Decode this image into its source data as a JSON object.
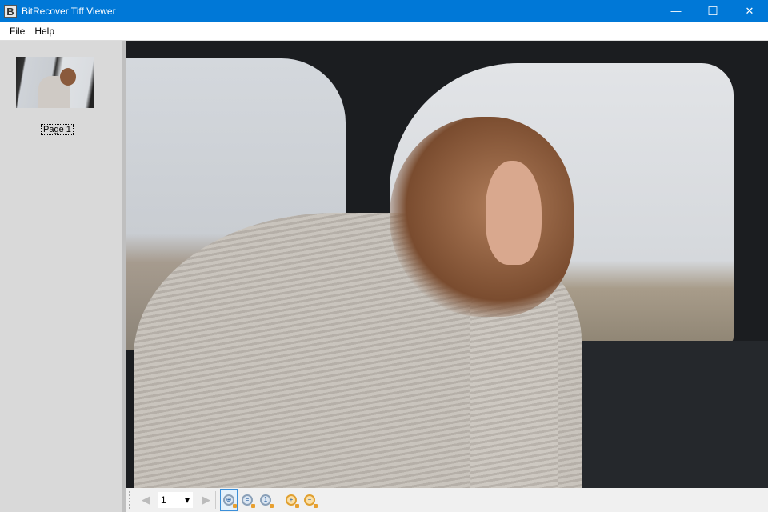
{
  "window": {
    "title": "BitRecover Tiff Viewer",
    "app_icon_letter": "B",
    "minimize": "—",
    "maximize": "☐",
    "close": "✕"
  },
  "menu": [
    {
      "label": "File"
    },
    {
      "label": "Help"
    }
  ],
  "sidebar": {
    "pages": [
      {
        "label": "Page 1"
      }
    ]
  },
  "toolbar": {
    "prev": "◀",
    "next": "▶",
    "page_value": "1",
    "dropdown": "▾",
    "fit": "⊕",
    "fit_width": "=",
    "actual": "1",
    "zoom_in": "+",
    "zoom_out": "−"
  },
  "colors": {
    "titlebar": "#0078d7",
    "sidebar": "#d9d9d9",
    "active_border": "#3b8fd9"
  }
}
